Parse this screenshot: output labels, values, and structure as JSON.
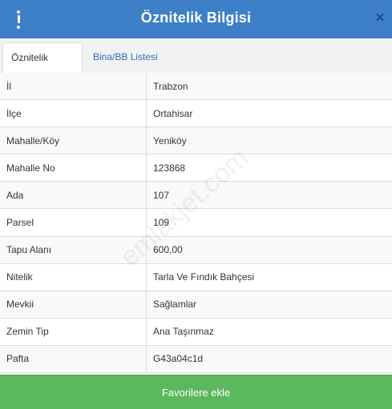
{
  "header": {
    "title": "Öznitelik Bilgisi",
    "close_symbol": "×",
    "menu_icon": "kebab-menu-icon",
    "color": "#3d80c8"
  },
  "tabs": [
    {
      "label": "Öznitelik Bilgisi",
      "active": true
    },
    {
      "label": "Bina/BB Listesi",
      "active": false
    }
  ],
  "attributes": [
    {
      "label": "İl",
      "value": "Trabzon"
    },
    {
      "label": "İlçe",
      "value": "Ortahisar"
    },
    {
      "label": "Mahalle/Köy",
      "value": "Yeniköy"
    },
    {
      "label": "Mahalle No",
      "value": "123868"
    },
    {
      "label": "Ada",
      "value": "107"
    },
    {
      "label": "Parsel",
      "value": "109"
    },
    {
      "label": "Tapu Alanı",
      "value": "600,00"
    },
    {
      "label": "Nitelik",
      "value": "Tarla Ve Fındık Bahçesi"
    },
    {
      "label": "Mevkii",
      "value": "Sağlamlar"
    },
    {
      "label": "Zemin Tip",
      "value": "Ana Taşınmaz"
    },
    {
      "label": "Pafta",
      "value": "G43a04c1d"
    }
  ],
  "watermark": "emlakjet.com",
  "footer": {
    "button_label": "Favorilere ekle",
    "color": "#5cb85c"
  }
}
